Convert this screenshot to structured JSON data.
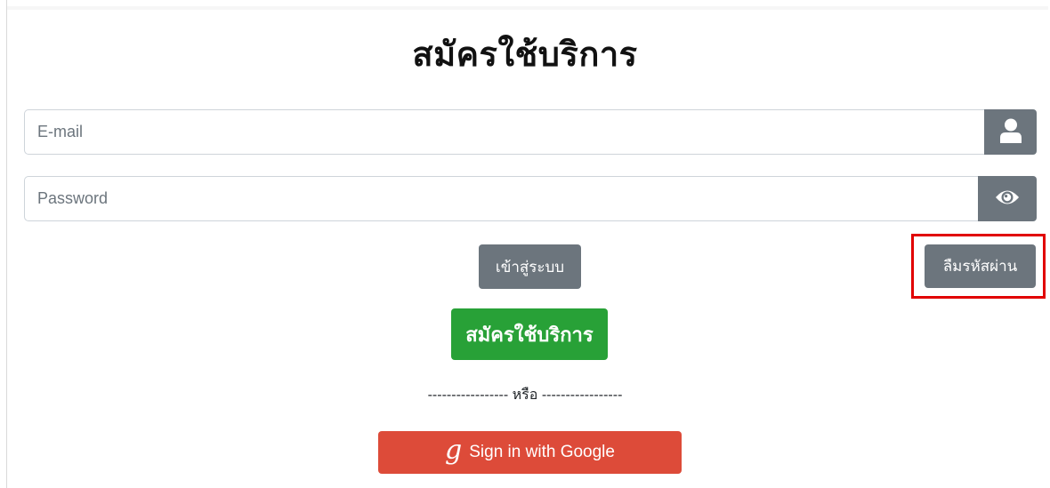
{
  "page": {
    "title": "สมัครใช้บริการ"
  },
  "email": {
    "placeholder": "E-mail",
    "icon": "user-icon"
  },
  "password": {
    "placeholder": "Password",
    "icon": "eye-icon"
  },
  "buttons": {
    "login_label": "เข้าสู่ระบบ",
    "forgot_label": "ลืมรหัสผ่าน",
    "register_label": "สมัครใช้บริการ",
    "google_label": "Sign in with Google",
    "google_logo": "g"
  },
  "divider": {
    "text": "----------------- หรือ -----------------"
  },
  "colors": {
    "secondary": "#6c757d",
    "success": "#28a137",
    "google": "#dd4b39",
    "highlight": "#e10000"
  }
}
